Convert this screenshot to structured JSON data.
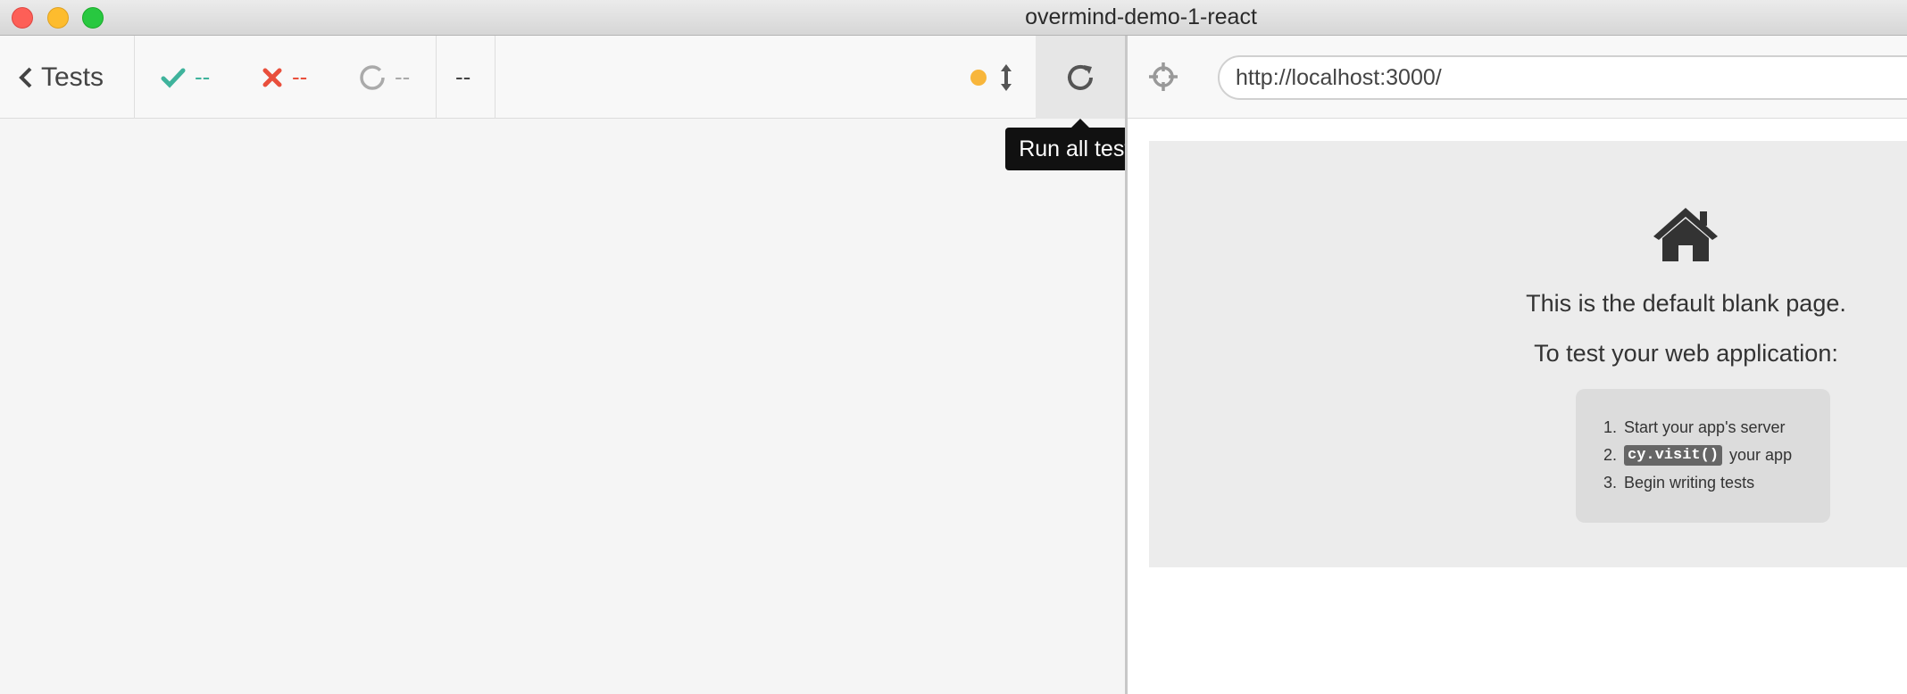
{
  "window": {
    "title": "overmind-demo-1-react"
  },
  "reporter": {
    "back_label": "Tests",
    "passed": "--",
    "failed": "--",
    "pending": "--",
    "duration": "--",
    "status_dot_color": "#f8b63b",
    "run_tooltip": "Run all tests"
  },
  "aut": {
    "url": "http://localhost:3000/",
    "blank_title": "This is the default blank page.",
    "blank_subtitle": "To test your web application:",
    "steps": [
      {
        "num": "1.",
        "pre": "Start your app's server",
        "code": "",
        "post": ""
      },
      {
        "num": "2.",
        "pre": "",
        "code": "cy.visit()",
        "post": "your app"
      },
      {
        "num": "3.",
        "pre": "Begin writing tests",
        "code": "",
        "post": ""
      }
    ]
  }
}
